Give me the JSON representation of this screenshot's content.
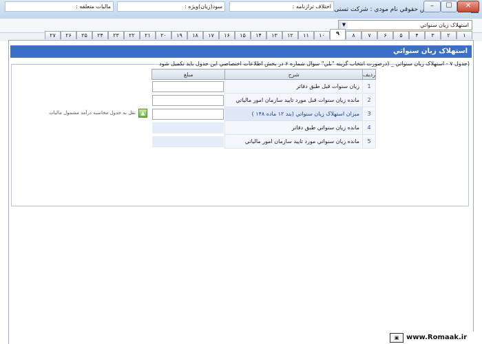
{
  "window": {
    "title": "اظهارنامه اشخاص حقوقي   نام مودي : شرکت تستی",
    "min_label": "–",
    "max_label": "☐",
    "close_label": "✕"
  },
  "info_row": {
    "combo_value": "استهلاک زيان سنواتي",
    "field1_label": "اختلاف ترازنامه :",
    "field2_label": "سود(زيان)ويژه :",
    "field3_label": "ماليات متعلقه :"
  },
  "tabs": [
    {
      "label": "۱",
      "active": false
    },
    {
      "label": "۲",
      "active": false
    },
    {
      "label": "۳",
      "active": false
    },
    {
      "label": "۴",
      "active": false
    },
    {
      "label": "۵",
      "active": false
    },
    {
      "label": "۶",
      "active": false
    },
    {
      "label": "۷",
      "active": false
    },
    {
      "label": "۸",
      "active": false
    },
    {
      "label": "۹",
      "active": true
    },
    {
      "label": "۱۰",
      "active": false
    },
    {
      "label": "۱۱",
      "active": false
    },
    {
      "label": "۱۲",
      "active": false
    },
    {
      "label": "۱۳",
      "active": false
    },
    {
      "label": "۱۴",
      "active": false
    },
    {
      "label": "۱۵",
      "active": false
    },
    {
      "label": "۱۶",
      "active": false
    },
    {
      "label": "۱۷",
      "active": false
    },
    {
      "label": "۱۸",
      "active": false
    },
    {
      "label": "۱۹",
      "active": false
    },
    {
      "label": "۲۰",
      "active": false
    },
    {
      "label": "۲۱",
      "active": false
    },
    {
      "label": "۲۲",
      "active": false
    },
    {
      "label": "۲۳",
      "active": false
    },
    {
      "label": "۲۴",
      "active": false
    },
    {
      "label": "۲۵",
      "active": false
    },
    {
      "label": "۲۶",
      "active": false
    },
    {
      "label": "۲۷",
      "active": false
    }
  ],
  "section": {
    "title": "استهلاک زيان سنواتي",
    "description": "(جدول ۷ - استهلاک زيان سنواتي _ (درصورت انتخاب گزينه \"بلي\" سوال شماره ۶ در بخش اطلاعات اختصاصي اين جدول بايد تکميل شود"
  },
  "table": {
    "col_num": "رديف",
    "col_desc": "شرح",
    "col_amount": "مبلغ",
    "rows": [
      {
        "num": "1",
        "desc": "زيان سنوات قبل طبق دفاتر",
        "amount_type": "input",
        "highlight": false
      },
      {
        "num": "2",
        "desc": "مانده زيان سنوات قبل مورد تاييد سازمان امور مالياتي",
        "amount_type": "input",
        "highlight": false
      },
      {
        "num": "3",
        "desc": "ميزان استهلاک زيان سنواتي (بند ۱۲ ماده ۱۴۸ )",
        "amount_type": "input",
        "highlight": true
      },
      {
        "num": "4",
        "desc": "مانده زيان سنواتي طبق دفاتر",
        "amount_type": "blue",
        "highlight": false
      },
      {
        "num": "5",
        "desc": "مانده زيان سنواتي مورد تاييد سازمان امور مالياتي",
        "amount_type": "blue",
        "highlight": false
      }
    ]
  },
  "transfer": {
    "icon": "up-arrow-icon",
    "label": "نقل به جدول محاسبه درآمد مشمول ماليات"
  },
  "footer": {
    "logo_icon": "romaak-logo-icon",
    "site": "www.Romaak.ir"
  },
  "colors": {
    "header_bar": "#3b6fc9",
    "highlight_row": "#dfe8f6"
  }
}
